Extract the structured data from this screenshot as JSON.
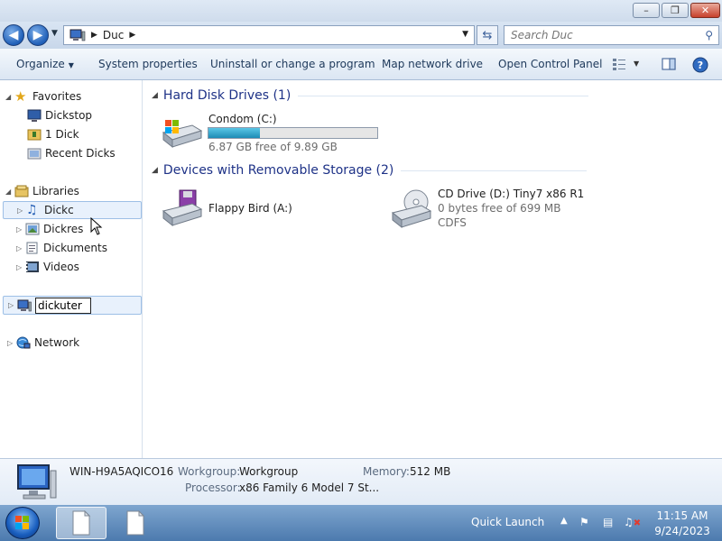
{
  "window": {
    "buttons": {
      "minimize": "–",
      "maximize": "❐",
      "close": "✕"
    }
  },
  "address": {
    "path": [
      "Duc"
    ],
    "search_placeholder": "Search Duc"
  },
  "toolbar": {
    "organize": "Organize",
    "system_properties": "System properties",
    "uninstall": "Uninstall or change a program",
    "map_drive": "Map network drive",
    "control_panel": "Open Control Panel"
  },
  "nav": {
    "favorites": "Favorites",
    "fav_items": [
      "Dickstop",
      "1 Dick",
      "Recent Dicks"
    ],
    "libraries": "Libraries",
    "lib_items": [
      "Dickc",
      "Dickres",
      "Dickuments",
      "Videos"
    ],
    "computer_rename_value": "dickuter",
    "network": "Network"
  },
  "content": {
    "group_hdd": "Hard Disk Drives (1)",
    "group_removable": "Devices with Removable Storage (2)",
    "drive_c": {
      "name": "Condom (C:)",
      "free": "6.87 GB free of 9.89 GB",
      "used_fraction": 0.305
    },
    "drive_a": {
      "name": "Flappy Bird (A:)"
    },
    "drive_d": {
      "name": "CD Drive (D:) Tiny7 x86 R1",
      "free": "0 bytes free of 699 MB",
      "fs": "CDFS"
    }
  },
  "details": {
    "computer_name": "WIN-H9A5AQICO16",
    "workgroup_label": "Workgroup:",
    "workgroup_value": "Workgroup",
    "memory_label": "Memory:",
    "memory_value": "512 MB",
    "processor_label": "Processor:",
    "processor_value": "x86 Family 6 Model 7 St..."
  },
  "taskbar": {
    "quick_launch": "Quick Launch",
    "time": "11:15 AM",
    "date": "9/24/2023"
  }
}
